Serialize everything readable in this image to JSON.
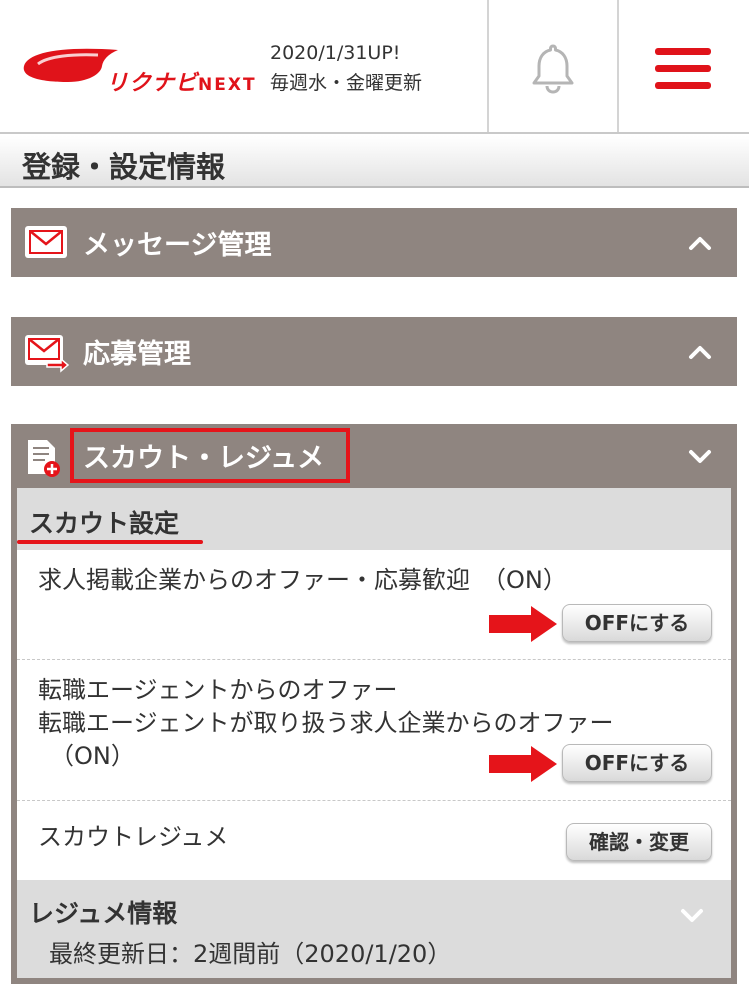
{
  "header": {
    "logo_text": "リクナビ",
    "logo_next": "NEXT",
    "update_date": "2020/1/31UP!",
    "update_schedule": "毎週水・金曜更新"
  },
  "page_title": "登録・設定情報",
  "sections": {
    "message": {
      "label": "メッセージ管理"
    },
    "application": {
      "label": "応募管理"
    },
    "scout": {
      "label": "スカウト・レジュメ"
    }
  },
  "scout_settings": {
    "title": "スカウト設定",
    "rows": [
      {
        "text_lines": [
          "求人掲載企業からのオファー・応募歓迎　（ON）"
        ],
        "button": "OFFにする"
      },
      {
        "text_lines": [
          "転職エージェントからのオファー",
          "転職エージェントが取り扱う求人企業からのオファー",
          "　（ON）"
        ],
        "button": "OFFにする"
      },
      {
        "text_lines": [
          "スカウトレジュメ"
        ],
        "button": "確認・変更"
      }
    ]
  },
  "resume_info": {
    "title": "レジュメ情報",
    "last_updated": "最終更新日：2週間前（2020/1/20）"
  },
  "colors": {
    "brand_red": "#e0131a",
    "section_bar": "#8f8580",
    "sub_header": "#dcdcdc"
  },
  "icons": [
    "bell-icon",
    "hamburger-menu-icon",
    "mail-icon",
    "mail-send-icon",
    "document-add-icon",
    "chevron-up-icon",
    "chevron-down-icon",
    "red-arrow-icon"
  ]
}
